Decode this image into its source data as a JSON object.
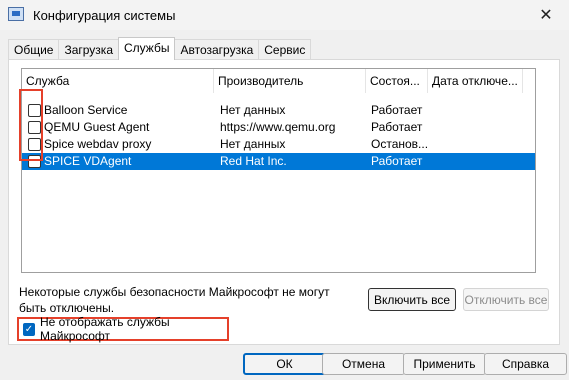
{
  "window": {
    "title": "Конфигурация системы",
    "close_glyph": "✕"
  },
  "tabs": [
    {
      "label": "Общие"
    },
    {
      "label": "Загрузка"
    },
    {
      "label": "Службы"
    },
    {
      "label": "Автозагрузка"
    },
    {
      "label": "Сервис"
    }
  ],
  "columns": [
    "Служба",
    "Производитель",
    "Состоя...",
    "Дата отключе..."
  ],
  "services": [
    {
      "name": "Balloon Service",
      "vendor": "Нет данных",
      "status": "Работает",
      "date": "",
      "checked": false,
      "selected": false
    },
    {
      "name": "QEMU Guest Agent",
      "vendor": "https://www.qemu.org",
      "status": "Работает",
      "date": "",
      "checked": false,
      "selected": false
    },
    {
      "name": "Spice webdav proxy",
      "vendor": "Нет данных",
      "status": "Останов...",
      "date": "",
      "checked": false,
      "selected": false
    },
    {
      "name": "SPICE VDAgent",
      "vendor": "Red Hat Inc.",
      "status": "Работает",
      "date": "",
      "checked": false,
      "selected": true
    }
  ],
  "note": "Некоторые службы безопасности Майкрософт не могут быть отключены.",
  "buttons": {
    "enable_all": "Включить все",
    "disable_all": "Отключить все",
    "ok": "ОК",
    "cancel": "Отмена",
    "apply": "Применить",
    "help": "Справка"
  },
  "hide_ms": {
    "label": "Не отображать службы Майкрософт",
    "checked": true
  },
  "colors": {
    "selection": "#0078d7",
    "highlight": "#e5402a",
    "accent": "#0067c0"
  }
}
